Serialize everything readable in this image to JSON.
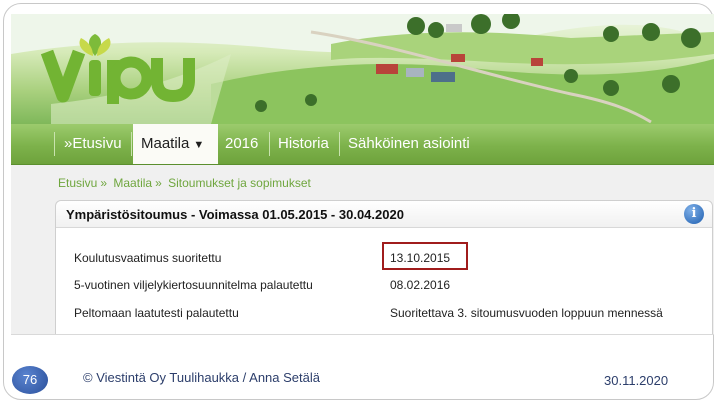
{
  "brand": {
    "logo_text": "vipu"
  },
  "nav": {
    "items": [
      {
        "label": "»Etusivu"
      },
      {
        "label": "Maatila"
      },
      {
        "label": "2016"
      },
      {
        "label": "Historia"
      },
      {
        "label": "Sähköinen asiointi"
      }
    ],
    "caret": "▼"
  },
  "breadcrumb": {
    "items": [
      "Etusivu",
      "Maatila",
      "Sitoumukset ja sopimukset"
    ],
    "separator": "»"
  },
  "panel": {
    "title": "Ympäristösitoumus - Voimassa 01.05.2015 - 30.04.2020",
    "info_icon": "i",
    "rows": [
      {
        "label": "Koulutusvaatimus suoritettu",
        "value": "13.10.2015"
      },
      {
        "label": "5-vuotinen viljelykiertosuunnitelma palautettu",
        "value": "08.02.2016"
      },
      {
        "label": "Peltomaan laatutesti palautettu",
        "value": "Suoritettava 3. sitoumusvuoden loppuun mennessä"
      }
    ]
  },
  "footer": {
    "page_number": "76",
    "copyright": "© Viestintä Oy Tuulihaukka / Anna Setälä",
    "date": "30.11.2020"
  },
  "colors": {
    "brand_green": "#72b433",
    "nav_green": "#7db24b",
    "highlight_red": "#a01c1c",
    "info_blue": "#1f5fb0"
  }
}
